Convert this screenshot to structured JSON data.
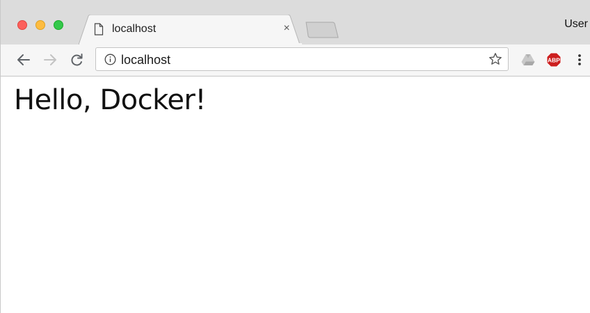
{
  "browser": {
    "tab": {
      "title": "localhost",
      "close_glyph": "×",
      "favicon": "document-icon"
    },
    "new_tab": "new-tab-icon",
    "profile_label": "User",
    "toolbar": {
      "back": "arrow-left-icon",
      "forward": "arrow-right-icon",
      "reload": "reload-icon",
      "address": {
        "security_icon": "info-icon",
        "url": "localhost",
        "bookmark": "star-icon"
      },
      "extensions": [
        "google-drive-icon",
        "adblock-plus-icon"
      ],
      "adblock_label": "ABP",
      "menu": "kebab-menu-icon"
    }
  },
  "page": {
    "heading": "Hello, Docker!"
  },
  "colors": {
    "tabstrip_bg": "#dcdcdc",
    "toolbar_bg": "#f6f6f6",
    "close_light": "#fc605c",
    "minimize_light": "#fdbc40",
    "maximize_light": "#34c84a",
    "abp_red": "#cc1f1f"
  }
}
